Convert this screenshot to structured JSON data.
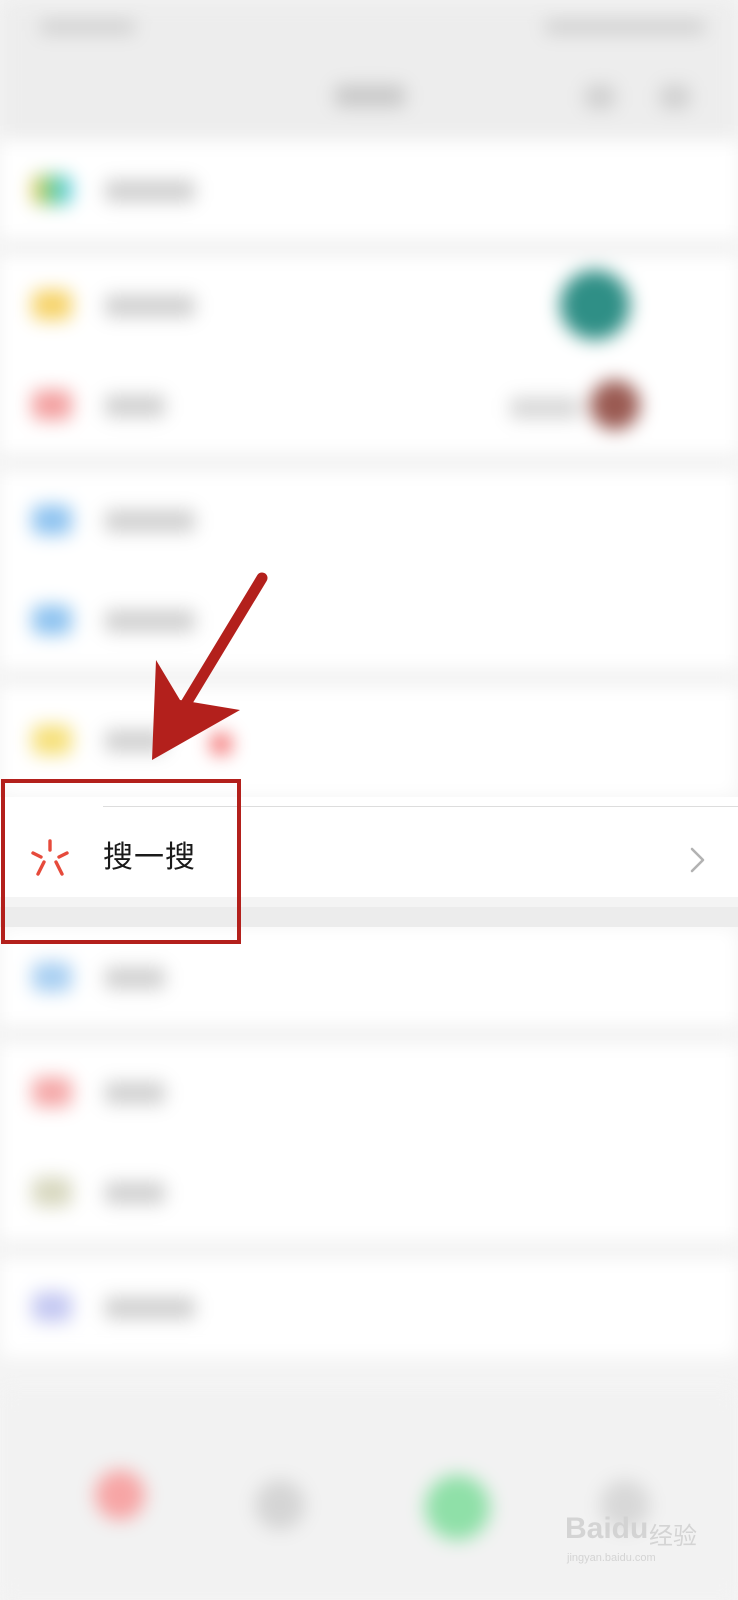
{
  "highlighted_item": {
    "label": "搜一搜",
    "icon": "search-sparkle-icon",
    "chevron": "chevron-right-icon"
  },
  "annotation": {
    "arrow_color": "#b3201c",
    "box_color": "#b3201c"
  },
  "watermark": {
    "logo": "Baidu",
    "text": "经验",
    "url": "jingyan.baidu.com"
  },
  "colors": {
    "icon_red": "#e64a3b",
    "text": "#1a1a1a",
    "chevron": "#b2b2b2",
    "list_background": "#ffffff",
    "page_background": "#f4f4f4"
  }
}
